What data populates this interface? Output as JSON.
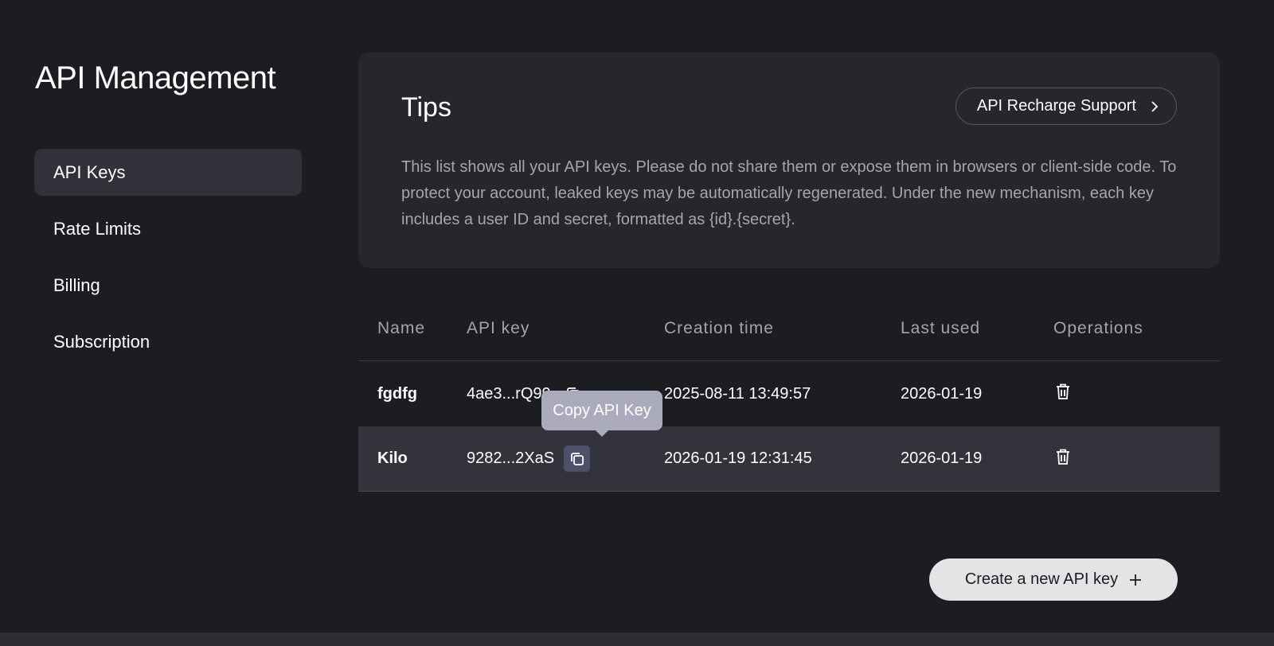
{
  "title": "API Management",
  "nav": [
    "API Keys",
    "Rate Limits",
    "Billing",
    "Subscription"
  ],
  "tips": {
    "title": "Tips",
    "recharge_label": "API Recharge Support",
    "text": "This list shows all your API keys. Please do not share them or expose them in browsers or client-side code. To protect your account, leaked keys may be automatically regenerated. Under the new mechanism, each key includes a user ID and secret, formatted as {id}.{secret}."
  },
  "table": {
    "headers": [
      "Name",
      "API key",
      "Creation time",
      "Last used",
      "Operations"
    ],
    "rows": [
      {
        "name": "fgdfg",
        "key": "4ae3...rQ99",
        "created": "2025-08-11 13:49:57",
        "last_used": "2026-01-19"
      },
      {
        "name": "Kilo",
        "key": "9282...2XaS",
        "created": "2026-01-19 12:31:45",
        "last_used": "2026-01-19"
      }
    ]
  },
  "tooltip": "Copy API Key",
  "create_label": "Create a new API key"
}
